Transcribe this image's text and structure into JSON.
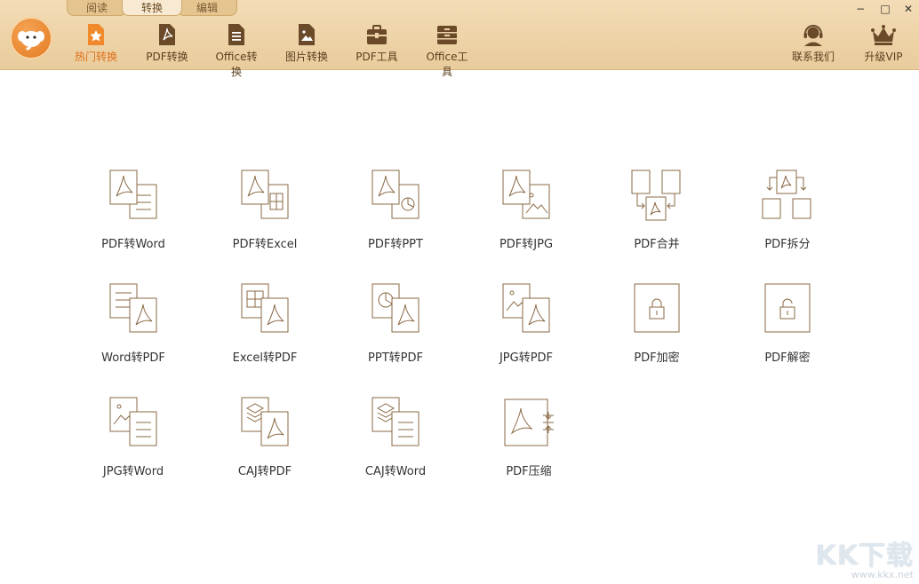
{
  "tabs": [
    {
      "label": "阅读",
      "active": false
    },
    {
      "label": "转换",
      "active": true
    },
    {
      "label": "编辑",
      "active": false
    }
  ],
  "toolbar": [
    {
      "label": "热门转换",
      "icon": "star-doc-icon",
      "active": true
    },
    {
      "label": "PDF转换",
      "icon": "pdf-doc-icon",
      "active": false
    },
    {
      "label": "Office转换",
      "icon": "office-doc-icon",
      "active": false
    },
    {
      "label": "图片转换",
      "icon": "image-doc-icon",
      "active": false
    },
    {
      "label": "PDF工具",
      "icon": "toolbox-icon",
      "active": false
    },
    {
      "label": "Office工具",
      "icon": "cabinet-icon",
      "active": false
    }
  ],
  "right_tools": {
    "contact": "联系我们",
    "upgrade": "升级VIP"
  },
  "window_controls": {
    "minimize": "−",
    "maximize": "□",
    "close": "✕"
  },
  "features": [
    {
      "label": "PDF转Word",
      "icon": "pdf-to-word-icon"
    },
    {
      "label": "PDF转Excel",
      "icon": "pdf-to-excel-icon"
    },
    {
      "label": "PDF转PPT",
      "icon": "pdf-to-ppt-icon"
    },
    {
      "label": "PDF转JPG",
      "icon": "pdf-to-jpg-icon"
    },
    {
      "label": "PDF合并",
      "icon": "pdf-merge-icon"
    },
    {
      "label": "PDF拆分",
      "icon": "pdf-split-icon"
    },
    {
      "label": "Word转PDF",
      "icon": "word-to-pdf-icon"
    },
    {
      "label": "Excel转PDF",
      "icon": "excel-to-pdf-icon"
    },
    {
      "label": "PPT转PDF",
      "icon": "ppt-to-pdf-icon"
    },
    {
      "label": "JPG转PDF",
      "icon": "jpg-to-pdf-icon"
    },
    {
      "label": "PDF加密",
      "icon": "pdf-encrypt-icon"
    },
    {
      "label": "PDF解密",
      "icon": "pdf-decrypt-icon"
    },
    {
      "label": "JPG转Word",
      "icon": "jpg-to-word-icon"
    },
    {
      "label": "CAJ转PDF",
      "icon": "caj-to-pdf-icon"
    },
    {
      "label": "CAJ转Word",
      "icon": "caj-to-word-icon"
    },
    {
      "label": "PDF压缩",
      "icon": "pdf-compress-icon"
    }
  ],
  "watermark": {
    "big": "KK下载",
    "small": "www.kkx.net"
  },
  "colors": {
    "accent": "#e0701a",
    "toolbar_bg": "#edd3a8",
    "icon_stroke": "#8a6a45"
  }
}
